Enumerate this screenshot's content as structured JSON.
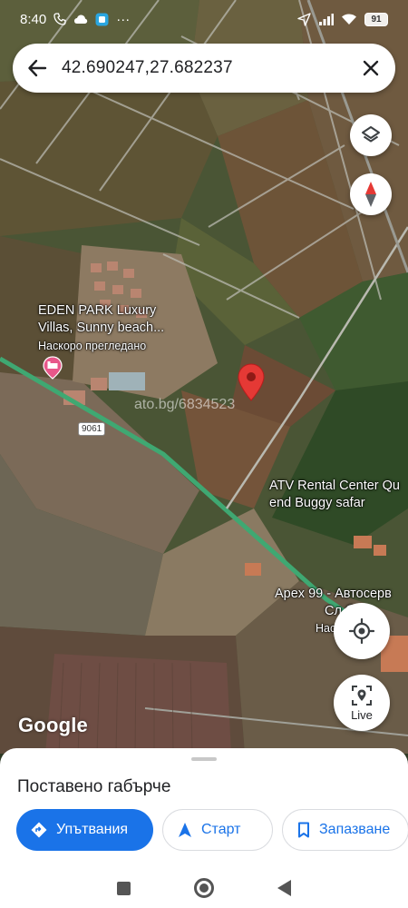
{
  "status_bar": {
    "time": "8:40",
    "more": "···",
    "battery": "91",
    "icons": [
      "phone-icon",
      "cloud-icon",
      "app-icon",
      "location-arrow-icon",
      "signal-icon",
      "wifi-icon",
      "battery-icon"
    ]
  },
  "search": {
    "query": "42.690247,27.682237",
    "back_icon": "arrow-back-icon",
    "clear_icon": "close-icon"
  },
  "map": {
    "labels": {
      "eden_line1": "EDEN PARK Luxury",
      "eden_line2": "Villas, Sunny beach...",
      "eden_sub": "Наскоро прегледано",
      "atv_line1": "ATV Rental Center Qu",
      "atv_line2": "end Buggy safar",
      "apex_line1": "Apex 99 - Автосерв",
      "apex_line2": "Сл бря",
      "apex_line3": "Насн ле"
    },
    "road_number": "9061",
    "watermark": "ato.bg/6834523",
    "google_logo": "Google",
    "pin_color": "#e53935",
    "hotel_pin_color": "#e8578a"
  },
  "controls": {
    "layers_icon": "layers-icon",
    "compass_icon": "compass-icon",
    "location_icon": "my-location-icon",
    "live_label": "Live"
  },
  "sheet": {
    "title": "Поставено габърче",
    "directions_label": "Упътвания",
    "start_label": "Старт",
    "save_label": "Запазване",
    "accent": "#1a73e8"
  }
}
